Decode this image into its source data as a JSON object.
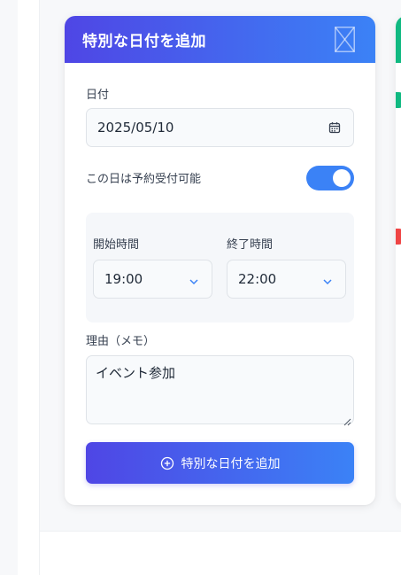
{
  "card": {
    "title": "特別な日付を追加",
    "close_icon": "close-x-box-icon"
  },
  "date": {
    "label": "日付",
    "value": "2025/05/10",
    "icon": "calendar-icon"
  },
  "availability": {
    "label": "この日は予約受付可能",
    "enabled": true
  },
  "time": {
    "start_label": "開始時間",
    "start_value": "19:00",
    "end_label": "終了時間",
    "end_value": "22:00"
  },
  "reason": {
    "label": "理由（メモ）",
    "value": "イベント参加"
  },
  "submit": {
    "label": "特別な日付を追加",
    "icon": "plus-circle-icon"
  },
  "colors": {
    "gradient_start": "#4f46e5",
    "gradient_end": "#3b82f6",
    "toggle_on": "#3b82f6",
    "side_green": "#10b981",
    "side_red": "#ef4444"
  }
}
